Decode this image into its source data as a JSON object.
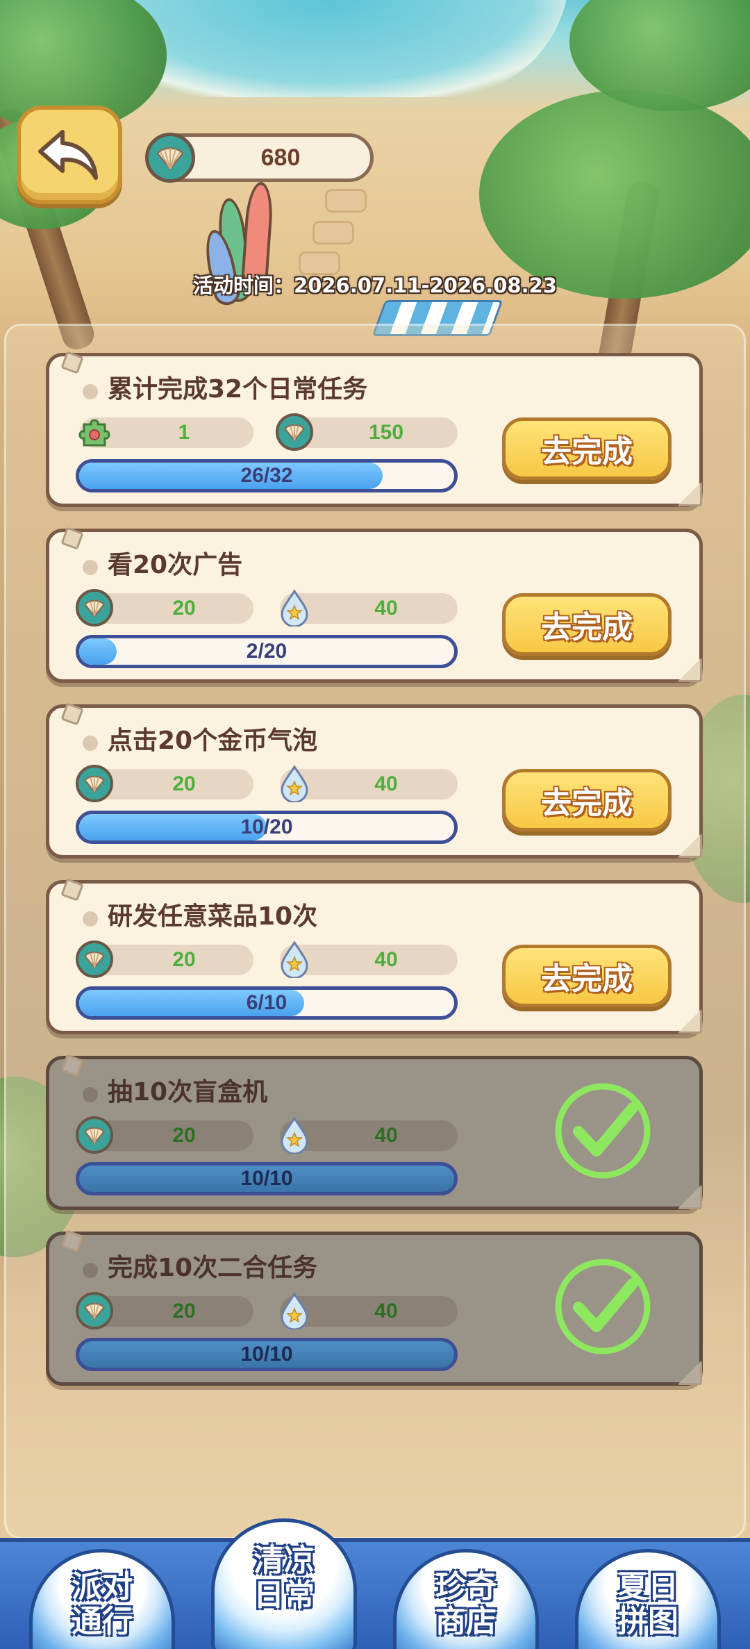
{
  "hud": {
    "currency_icon": "shell-icon",
    "currency_value": "680",
    "event_time": "活动时间：2026.07.11-2026.08.23"
  },
  "tasks": [
    {
      "title": "累计完成32个日常任务",
      "reward1": {
        "icon": "puzzle-piece-icon",
        "value": "1"
      },
      "reward2": {
        "icon": "shell-icon",
        "value": "150"
      },
      "progress": {
        "current": 26,
        "total": 32,
        "text": "26/32"
      },
      "button": "去完成",
      "completed": false
    },
    {
      "title": "看20次广告",
      "reward1": {
        "icon": "shell-icon",
        "value": "20"
      },
      "reward2": {
        "icon": "water-drop-icon",
        "value": "40"
      },
      "progress": {
        "current": 2,
        "total": 20,
        "text": "2/20"
      },
      "button": "去完成",
      "completed": false
    },
    {
      "title": "点击20个金币气泡",
      "reward1": {
        "icon": "shell-icon",
        "value": "20"
      },
      "reward2": {
        "icon": "water-drop-icon",
        "value": "40"
      },
      "progress": {
        "current": 10,
        "total": 20,
        "text": "10/20"
      },
      "button": "去完成",
      "completed": false
    },
    {
      "title": "研发任意菜品10次",
      "reward1": {
        "icon": "shell-icon",
        "value": "20"
      },
      "reward2": {
        "icon": "water-drop-icon",
        "value": "40"
      },
      "progress": {
        "current": 6,
        "total": 10,
        "text": "6/10"
      },
      "button": "去完成",
      "completed": false
    },
    {
      "title": "抽10次盲盒机",
      "reward1": {
        "icon": "shell-icon",
        "value": "20"
      },
      "reward2": {
        "icon": "water-drop-icon",
        "value": "40"
      },
      "progress": {
        "current": 10,
        "total": 10,
        "text": "10/10"
      },
      "completed": true
    },
    {
      "title": "完成10次二合任务",
      "reward1": {
        "icon": "shell-icon",
        "value": "20"
      },
      "reward2": {
        "icon": "water-drop-icon",
        "value": "40"
      },
      "progress": {
        "current": 10,
        "total": 10,
        "text": "10/10"
      },
      "completed": true
    }
  ],
  "nav": {
    "tabs": [
      {
        "label": "派对\n通行",
        "active": false
      },
      {
        "label": "清凉\n日常",
        "active": true
      },
      {
        "label": "珍奇\n商店",
        "active": false
      },
      {
        "label": "夏日\n拼图",
        "active": false
      }
    ]
  },
  "colors": {
    "button_yellow": "#f7c844",
    "progress_blue": "#4aa3ee",
    "reward_green": "#4fae3f",
    "check_green": "#8ee85f"
  }
}
